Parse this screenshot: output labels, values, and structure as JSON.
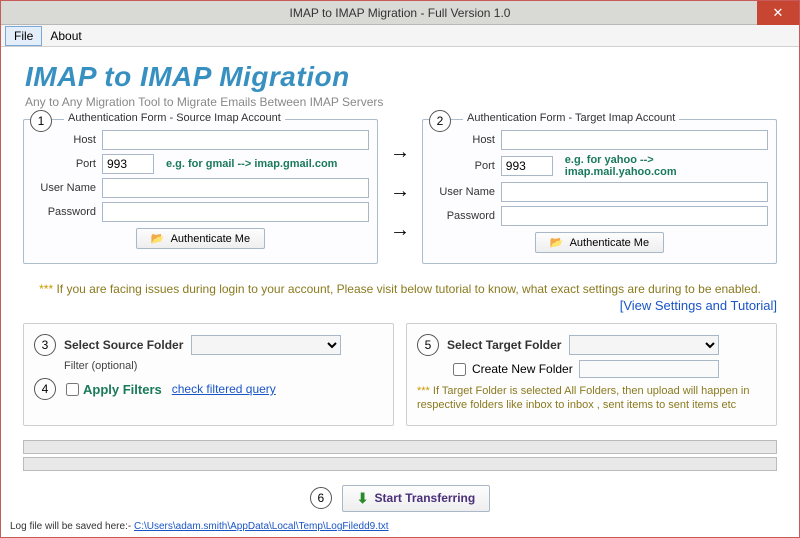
{
  "window": {
    "title": "IMAP to IMAP Migration - Full Version 1.0"
  },
  "menu": {
    "file": "File",
    "about": "About"
  },
  "header": {
    "title": "IMAP to IMAP Migration",
    "subtitle": "Any to Any Migration Tool to Migrate Emails Between IMAP Servers"
  },
  "source": {
    "legend": "Authentication Form - Source Imap Account",
    "step": "1",
    "host_label": "Host",
    "host_value": "",
    "port_label": "Port",
    "port_value": "993",
    "hint": "e.g. for gmail -->  imap.gmail.com",
    "user_label": "User Name",
    "user_value": "",
    "pass_label": "Password",
    "pass_value": "",
    "auth_btn": "Authenticate Me"
  },
  "target": {
    "legend": "Authentication Form - Target  Imap Account",
    "step": "2",
    "host_label": "Host",
    "host_value": "",
    "port_label": "Port",
    "port_value": "993",
    "hint": "e.g. for yahoo --> imap.mail.yahoo.com",
    "user_label": "User Name",
    "user_value": "",
    "pass_label": "Password",
    "pass_value": "",
    "auth_btn": "Authenticate Me"
  },
  "issues": {
    "stars": "***",
    "text": " If you are facing issues during login to your account, Please visit below tutorial to know, what exact settings are during to be enabled.",
    "link": "[View Settings and Tutorial]"
  },
  "source_folder": {
    "step": "3",
    "label": "Select Source Folder",
    "filter_title": "Filter (optional)",
    "filter_step": "4",
    "apply": "Apply Filters",
    "check_link": "check filtered query"
  },
  "target_folder": {
    "step": "5",
    "label": "Select Target Folder",
    "create_label": "Create New Folder",
    "note_stars": "***",
    "note": " If Target Folder is selected All Folders, then upload will happen in respective folders like inbox to inbox , sent items to sent items etc"
  },
  "start": {
    "step": "6",
    "label": "Start Transferring"
  },
  "log": {
    "prefix": "Log file will be saved here:-   ",
    "path": "C:\\Users\\adam.smith\\AppData\\Local\\Temp\\LogFiledd9.txt"
  }
}
